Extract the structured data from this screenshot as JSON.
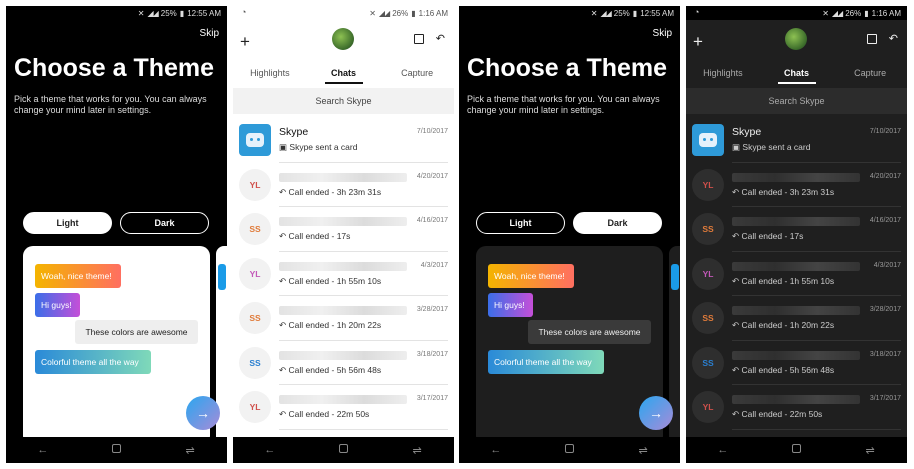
{
  "theme_light_screen": {
    "status_time": "12:55 AM",
    "battery": "25%",
    "skip": "Skip",
    "title": "Choose a Theme",
    "subtitle": "Pick a theme that works for you. You can always change your mind later in settings.",
    "light_label": "Light",
    "dark_label": "Dark",
    "selected": "Light",
    "messages": [
      "Woah, nice theme!",
      "Hi guys!",
      "These colors are awesome",
      "Colorful theme all the way"
    ],
    "next_icon": "→"
  },
  "theme_dark_screen": {
    "status_time": "12:55 AM",
    "battery": "25%",
    "skip": "Skip",
    "title": "Choose a Theme",
    "subtitle": "Pick a theme that works for you. You can always change your mind later in settings.",
    "light_label": "Light",
    "dark_label": "Dark",
    "selected": "Dark",
    "messages": [
      "Woah, nice theme!",
      "Hi guys!",
      "These colors are awesome",
      "Colorful theme all the way"
    ],
    "next_icon": "→"
  },
  "chats_light_screen": {
    "status_time": "1:16 AM",
    "battery": "26%",
    "tabs": [
      "Highlights",
      "Chats",
      "Capture"
    ],
    "active_tab": "Chats",
    "search_placeholder": "Search Skype",
    "chats": [
      {
        "avatar": "skype-bot",
        "name": "Skype",
        "date": "7/10/2017",
        "preview": "Skype sent a card",
        "initials_color": "#2e9ad8"
      },
      {
        "avatar": "YL",
        "name": "",
        "date": "4/20/2017",
        "preview": "Call ended - 3h 23m 31s",
        "initials_color": "#d0504b"
      },
      {
        "avatar": "SS",
        "name": "",
        "date": "4/16/2017",
        "preview": "Call ended - 17s",
        "initials_color": "#e07b3a"
      },
      {
        "avatar": "YL",
        "name": "",
        "date": "4/3/2017",
        "preview": "Call ended - 1h 55m 10s",
        "initials_color": "#c258b8"
      },
      {
        "avatar": "SS",
        "name": "",
        "date": "3/28/2017",
        "preview": "Call ended - 1h 20m 22s",
        "initials_color": "#e07b3a"
      },
      {
        "avatar": "SS",
        "name": "",
        "date": "3/18/2017",
        "preview": "Call ended - 5h 56m 48s",
        "initials_color": "#2a7fd0"
      },
      {
        "avatar": "YL",
        "name": "",
        "date": "3/17/2017",
        "preview": "Call ended - 22m 50s",
        "initials_color": "#d0504b"
      }
    ]
  },
  "chats_dark_screen": {
    "status_time": "1:16 AM",
    "battery": "26%",
    "tabs": [
      "Highlights",
      "Chats",
      "Capture"
    ],
    "active_tab": "Chats",
    "search_placeholder": "Search Skype",
    "chats": [
      {
        "avatar": "skype-bot",
        "name": "Skype",
        "date": "7/10/2017",
        "preview": "Skype sent a card",
        "initials_color": "#2e9ad8"
      },
      {
        "avatar": "YL",
        "name": "",
        "date": "4/20/2017",
        "preview": "Call ended - 3h 23m 31s",
        "initials_color": "#d0504b"
      },
      {
        "avatar": "SS",
        "name": "",
        "date": "4/16/2017",
        "preview": "Call ended - 17s",
        "initials_color": "#e07b3a"
      },
      {
        "avatar": "YL",
        "name": "",
        "date": "4/3/2017",
        "preview": "Call ended - 1h 55m 10s",
        "initials_color": "#c258b8"
      },
      {
        "avatar": "SS",
        "name": "",
        "date": "3/28/2017",
        "preview": "Call ended - 1h 20m 22s",
        "initials_color": "#e07b3a"
      },
      {
        "avatar": "SS",
        "name": "",
        "date": "3/18/2017",
        "preview": "Call ended - 5h 56m 48s",
        "initials_color": "#2a7fd0"
      },
      {
        "avatar": "YL",
        "name": "",
        "date": "3/17/2017",
        "preview": "Call ended - 22m 50s",
        "initials_color": "#d0504b"
      }
    ]
  },
  "icons": {
    "plus": "+",
    "call_glyph": "↶",
    "card_glyph": "▣",
    "back": "←",
    "recent": "⇌"
  }
}
